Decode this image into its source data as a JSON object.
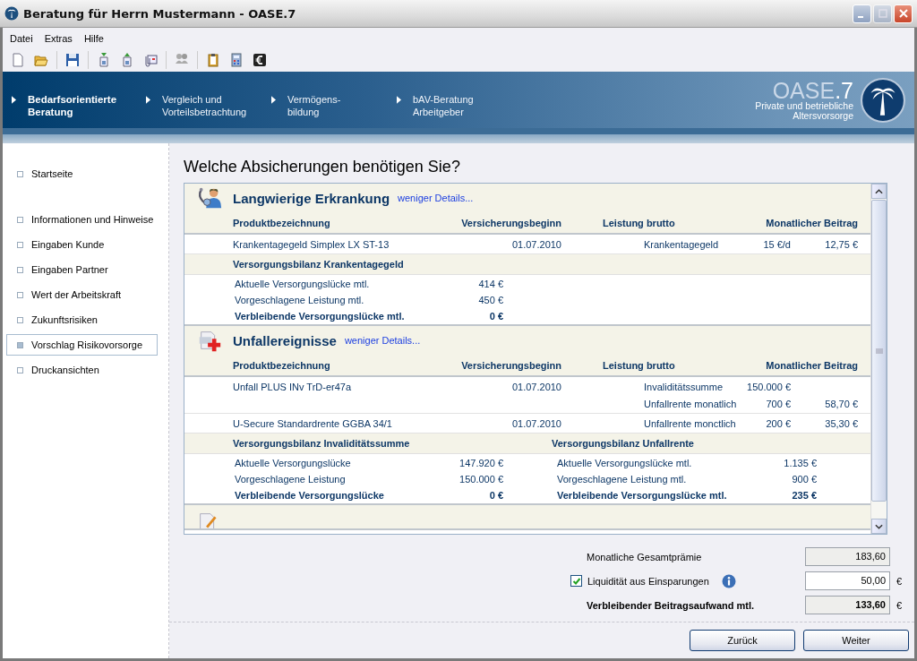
{
  "window": {
    "title": "Beratung für Herrn Mustermann - OASE.7"
  },
  "menu": [
    "Datei",
    "Extras",
    "Hilfe"
  ],
  "steps": [
    {
      "label": "Bedarfsorientierte Beratung",
      "selected": true
    },
    {
      "label": "Vergleich und Vorteilsbetrachtung",
      "selected": false
    },
    {
      "label": "Vermögens-bildung",
      "selected": false
    },
    {
      "label": "bAV-Beratung Arbeitgeber",
      "selected": false
    }
  ],
  "logo": {
    "name": "OASE",
    "version": ".7",
    "tagline": [
      "Private und betriebliche",
      "Altersvorsorge"
    ]
  },
  "sidebar": {
    "groups": [
      {
        "items": [
          {
            "label": "Startseite",
            "selected": false
          }
        ]
      },
      {
        "items": [
          {
            "label": "Informationen und Hinweise",
            "selected": false
          },
          {
            "label": "Eingaben Kunde",
            "selected": false
          },
          {
            "label": "Eingaben Partner",
            "selected": false
          },
          {
            "label": "Wert der Arbeitskraft",
            "selected": false
          },
          {
            "label": "Zukunftsrisiken",
            "selected": false
          },
          {
            "label": "Vorschlag Risikovorsorge",
            "selected": true
          },
          {
            "label": "Druckansichten",
            "selected": false
          }
        ]
      }
    ]
  },
  "heading": "Welche Absicherungen benötigen Sie?",
  "sections": [
    {
      "kind": "illness",
      "title": "Langwierige Erkrankung",
      "link": "weniger Details...",
      "columns": [
        "Produktbezeichnung",
        "Versicherungsbeginn",
        "Leistung brutto",
        "Monatlicher Beitrag"
      ],
      "rows": [
        {
          "product": "Krankentagegeld Simplex LX ST-13",
          "start": "01.07.2010",
          "benefits": [
            {
              "label": "Krankentagegeld",
              "value": "15 €/d",
              "premium": "12,75 €"
            }
          ]
        }
      ],
      "balances": [
        {
          "title": "Versorgungsbilanz Krankentagegeld",
          "lines": [
            {
              "label": "Aktuelle Versorgungslücke mtl.",
              "value": "414 €",
              "bold": false
            },
            {
              "label": "Vorgeschlagene Leistung mtl.",
              "value": "450 €",
              "bold": false
            },
            {
              "label": "Verbleibende Versorgungslücke mtl.",
              "value": "0 €",
              "bold": true
            }
          ]
        }
      ]
    },
    {
      "kind": "accident",
      "title": "Unfallereignisse",
      "link": "weniger Details...",
      "columns": [
        "Produktbezeichnung",
        "Versicherungsbeginn",
        "Leistung brutto",
        "Monatlicher Beitrag"
      ],
      "rows": [
        {
          "product": "Unfall PLUS INv TrD-er47a",
          "start": "01.07.2010",
          "benefits": [
            {
              "label": "Invaliditätssumme",
              "value": "150.000 €"
            },
            {
              "label": "Unfallrente monatlich",
              "value": "700 €",
              "premium": "58,70 €"
            }
          ]
        },
        {
          "product": "U-Secure Standardrente GGBA 34/1",
          "start": "01.07.2010",
          "benefits": [
            {
              "label": "Unfallrente monctlich",
              "value": "200 €",
              "premium": "35,30 €"
            }
          ]
        }
      ],
      "balances": [
        {
          "title": "Versorgungsbilanz Invaliditätssumme",
          "lines": [
            {
              "label": "Aktuelle Versorgungslücke",
              "value": "147.920 €",
              "bold": false
            },
            {
              "label": "Vorgeschlagene Leistung",
              "value": "150.000 €",
              "bold": false
            },
            {
              "label": "Verbleibende Versorgungslücke",
              "value": "0 €",
              "bold": true
            }
          ]
        },
        {
          "title": "Versorgungsbilanz Unfallrente",
          "lines": [
            {
              "label": "Aktuelle Versorgungslücke mtl.",
              "value": "1.135 €",
              "bold": false
            },
            {
              "label": "Vorgeschlagene Leistung mtl.",
              "value": "900 €",
              "bold": false
            },
            {
              "label": "Verbleibende Versorgungslücke mtl.",
              "value": "235 €",
              "bold": true
            }
          ]
        }
      ]
    },
    {
      "kind": "disability"
    }
  ],
  "totals": [
    {
      "kind": "readonly",
      "label": "Monatliche Gesamtprämie",
      "value": "183,60",
      "bold": false
    },
    {
      "kind": "checkbox",
      "label": "Liquidität aus Einsparungen",
      "checked": true,
      "value": "50,00",
      "unit": "€",
      "bold": false
    },
    {
      "kind": "readonly",
      "label": "Verbleibender Beitragsaufwand mtl.",
      "value": "133,60",
      "unit": "€",
      "bold": true
    }
  ],
  "buttons": [
    "Zurück",
    "Weiter"
  ]
}
